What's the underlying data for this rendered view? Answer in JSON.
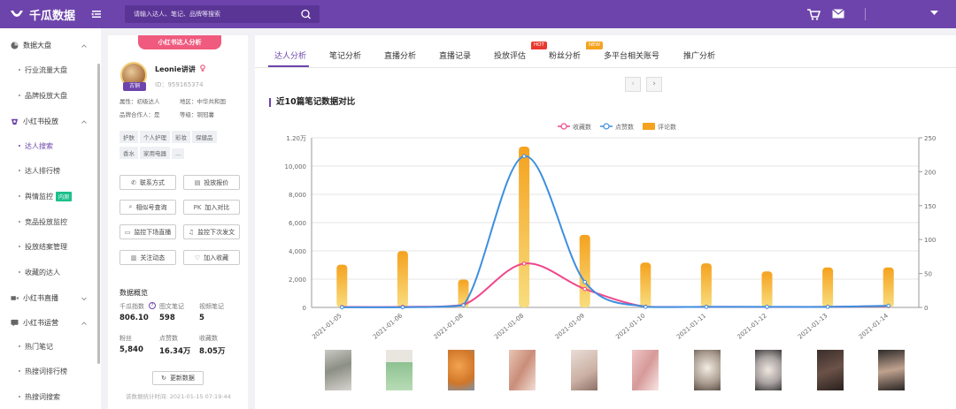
{
  "app": {
    "name": "千瓜数据"
  },
  "search": {
    "placeholder": "请输入达人、笔记、品牌等搜索"
  },
  "sidebar": {
    "groups": [
      {
        "label": "数据大盘",
        "items": [
          "行业流量大盘",
          "品牌投放大盘"
        ]
      },
      {
        "label": "小红书投放",
        "items": [
          "达人搜索",
          "达人排行榜",
          "舆情监控",
          "竞品投放监控",
          "投放结案管理",
          "收藏的达人"
        ]
      },
      {
        "label": "小红书直播",
        "items": []
      },
      {
        "label": "小红书运营",
        "items": [
          "热门笔记",
          "热搜词排行榜",
          "热搜词搜索"
        ]
      }
    ],
    "badge": "内测"
  },
  "profile": {
    "tag": "小红书达人分析",
    "name": "Leonie讲讲",
    "level_badge": "古铜",
    "id": "ID：959165374",
    "attr": "属性：初级达人",
    "region": "地区：中华共和国",
    "brand_coop": "品牌合作人：是",
    "rank": "等级：铜冠薯",
    "tags": [
      "护肤",
      "个人护理",
      "彩妆",
      "保健品",
      "香水",
      "家用电器",
      "..."
    ],
    "buttons": [
      "联系方式",
      "投放报价",
      "相似号查询",
      "加入对比",
      "监控下场直播",
      "监控下次发文",
      "关注动态",
      "加入收藏"
    ],
    "data_title": "数据概览",
    "stats": [
      {
        "label": "千瓜指数",
        "value": "806.10"
      },
      {
        "label": "图文笔记",
        "value": "598"
      },
      {
        "label": "视频笔记",
        "value": "5"
      },
      {
        "label": "粉丝",
        "value": "5,840"
      },
      {
        "label": "点赞数",
        "value": "16.34万"
      },
      {
        "label": "收藏数",
        "value": "8.05万"
      }
    ],
    "refresh": "更新数据",
    "stat_time": "该数据统计时间: 2021-01-15 07:19:44"
  },
  "tabs": [
    {
      "label": "达人分析"
    },
    {
      "label": "笔记分析"
    },
    {
      "label": "直播分析"
    },
    {
      "label": "直播记录"
    },
    {
      "label": "投放评估",
      "badge": "HOT"
    },
    {
      "label": "粉丝分析",
      "badge": "NEW"
    },
    {
      "label": "多平台相关账号"
    },
    {
      "label": "推广分析"
    }
  ],
  "section_title": "近10篇笔记数据对比",
  "chart_data": {
    "type": "bar",
    "categories": [
      "2021-01-05",
      "2021-01-06",
      "2021-01-08",
      "2021-01-08",
      "2021-01-09",
      "2021-01-10",
      "2021-01-11",
      "2021-01-12",
      "2021-01-13",
      "2021-01-14"
    ],
    "series": [
      {
        "name": "收藏数",
        "type": "line",
        "axis": "left",
        "color": "#f0478a",
        "values": [
          30,
          40,
          180,
          3100,
          1300,
          50,
          40,
          30,
          40,
          90
        ]
      },
      {
        "name": "点赞数",
        "type": "line",
        "axis": "left",
        "color": "#3d8ee0",
        "values": [
          10,
          10,
          150,
          10700,
          1800,
          40,
          40,
          40,
          40,
          120
        ]
      },
      {
        "name": "评论数",
        "type": "bar",
        "axis": "right",
        "color": "#f5a21f",
        "values": [
          63,
          83,
          41,
          237,
          107,
          66,
          65,
          53,
          59,
          59
        ]
      }
    ],
    "y_left": {
      "ticks": [
        "0",
        "2,000",
        "4,000",
        "6,000",
        "8,000",
        "10,000",
        "1.20万"
      ],
      "range": [
        0,
        12000
      ]
    },
    "y_right": {
      "ticks": [
        "0",
        "50",
        "100",
        "150",
        "200",
        "250"
      ],
      "range": [
        0,
        250
      ]
    },
    "legend": "top-center",
    "grid": true
  }
}
